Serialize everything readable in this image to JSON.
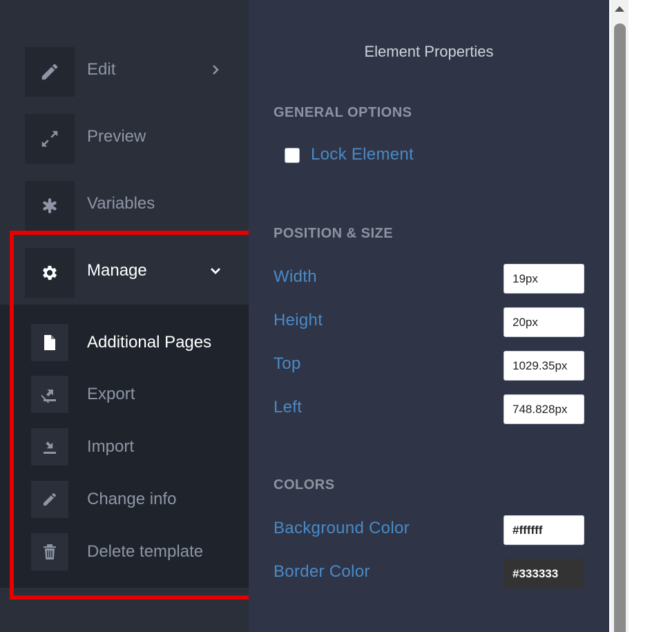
{
  "sidebar": {
    "items": [
      {
        "label": "Edit",
        "icon": "pencil-icon",
        "has_chevron": "right"
      },
      {
        "label": "Preview",
        "icon": "expand-icon"
      },
      {
        "label": "Variables",
        "icon": "asterisk-icon"
      },
      {
        "label": "Manage",
        "icon": "gear-icon",
        "has_chevron": "down",
        "active": true
      }
    ],
    "submenu": [
      {
        "label": "Additional Pages",
        "icon": "file-icon",
        "active": true
      },
      {
        "label": "Export",
        "icon": "export-icon"
      },
      {
        "label": "Import",
        "icon": "import-icon"
      },
      {
        "label": "Change info",
        "icon": "pencil-icon"
      },
      {
        "label": "Delete template",
        "icon": "trash-icon"
      }
    ]
  },
  "panel": {
    "title": "Element Properties",
    "general": {
      "heading": "GENERAL OPTIONS",
      "lock_label": "Lock Element",
      "lock_checked": false
    },
    "position": {
      "heading": "POSITION & SIZE",
      "fields": [
        {
          "label": "Width",
          "value": "19px"
        },
        {
          "label": "Height",
          "value": "20px"
        },
        {
          "label": "Top",
          "value": "1029.35px"
        },
        {
          "label": "Left",
          "value": "748.828px"
        }
      ]
    },
    "colors": {
      "heading": "COLORS",
      "fields": [
        {
          "label": "Background Color",
          "value": "#ffffff"
        },
        {
          "label": "Border Color",
          "value": "#333333"
        }
      ]
    }
  },
  "theme": {
    "sidebar_bg": "#2b2f3a",
    "submenu_bg": "#1f232b",
    "panel_bg": "#2f3547",
    "label_blue": "#4a8ac6",
    "highlight": "#e60000"
  }
}
